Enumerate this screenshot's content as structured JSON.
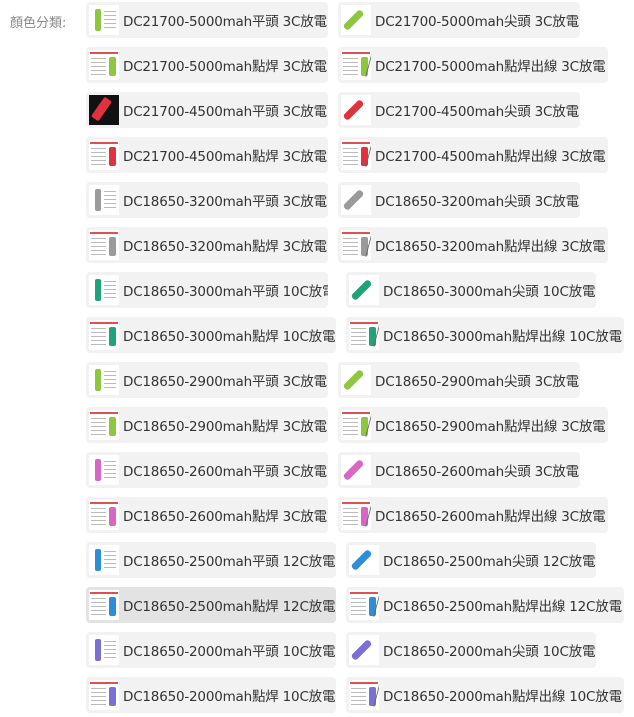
{
  "label": "顏色分類:",
  "colors": {
    "green_lime": "#8dc63f",
    "red": "#e0323c",
    "gray": "#9a9a9a",
    "teal": "#1fa37a",
    "pink": "#d867c4",
    "blue": "#2b8ed6",
    "purple": "#7b6fd6"
  },
  "rows": [
    {
      "left": "DC21700-5000mah平頭 3C放電",
      "right": "DC21700-5000mah尖頭 3C放電"
    },
    {
      "left": "DC21700-5000mah點焊 3C放電",
      "right": "DC21700-5000mah點焊出線 3C放電"
    },
    {
      "left": "DC21700-4500mah平頭 3C放電",
      "right": "DC21700-4500mah尖頭 3C放電"
    },
    {
      "left": "DC21700-4500mah點焊 3C放電",
      "right": "DC21700-4500mah點焊出線 3C放電"
    },
    {
      "left": "DC18650-3200mah平頭 3C放電",
      "right": "DC18650-3200mah尖頭 3C放電"
    },
    {
      "left": "DC18650-3200mah點焊 3C放電",
      "right": "DC18650-3200mah點焊出線 3C放電"
    },
    {
      "left": "DC18650-3000mah平頭 10C放電",
      "right": "DC18650-3000mah尖頭 10C放電"
    },
    {
      "left": "DC18650-3000mah點焊 10C放電",
      "right": "DC18650-3000mah點焊出線 10C放電"
    },
    {
      "left": "DC18650-2900mah平頭 3C放電",
      "right": "DC18650-2900mah尖頭 3C放電"
    },
    {
      "left": "DC18650-2900mah點焊 3C放電",
      "right": "DC18650-2900mah點焊出線 3C放電"
    },
    {
      "left": "DC18650-2600mah平頭 3C放電",
      "right": "DC18650-2600mah尖頭 3C放電"
    },
    {
      "left": "DC18650-2600mah點焊 3C放電",
      "right": "DC18650-2600mah點焊出線 3C放電"
    },
    {
      "left": "DC18650-2500mah平頭 12C放電",
      "right": "DC18650-2500mah尖頭 12C放電"
    },
    {
      "left": "DC18650-2500mah點焊 12C放電",
      "right": "DC18650-2500mah點焊出線 12C放電"
    },
    {
      "left": "DC18650-2000mah平頭 10C放電",
      "right": "DC18650-2000mah尖頭 10C放電"
    },
    {
      "left": "DC18650-2000mah點焊 10C放電",
      "right": "DC18650-2000mah點焊出線 10C放電"
    }
  ],
  "selected": "DC18650-2500mah點焊 12C放電"
}
